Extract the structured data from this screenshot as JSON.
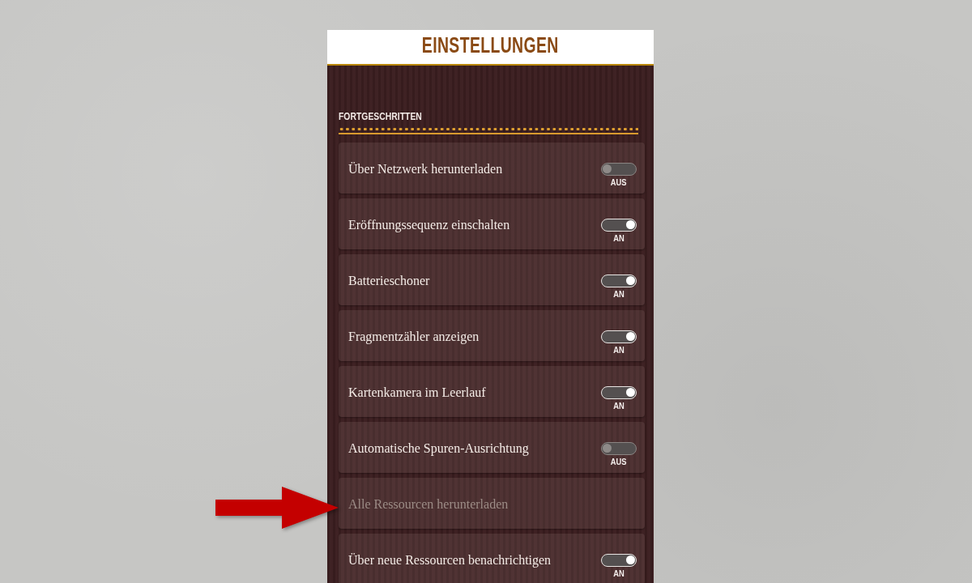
{
  "header": {
    "title": "EINSTELLUNGEN"
  },
  "section": {
    "title": "FORTGESCHRITTEN"
  },
  "settings": [
    {
      "kind": "toggle",
      "label": "Über Netzwerk herunterladen",
      "on": false,
      "state_label": "AUS",
      "disabled": false,
      "highlighted": false
    },
    {
      "kind": "toggle",
      "label": "Eröffnungssequenz einschalten",
      "on": true,
      "state_label": "AN",
      "disabled": false,
      "highlighted": false
    },
    {
      "kind": "toggle",
      "label": "Batterieschoner",
      "on": true,
      "state_label": "AN",
      "disabled": false,
      "highlighted": false
    },
    {
      "kind": "toggle",
      "label": "Fragmentzähler anzeigen",
      "on": true,
      "state_label": "AN",
      "disabled": false,
      "highlighted": false
    },
    {
      "kind": "toggle",
      "label": "Kartenkamera im Leerlauf",
      "on": true,
      "state_label": "AN",
      "disabled": false,
      "highlighted": false
    },
    {
      "kind": "toggle",
      "label": "Automatische Spuren-Ausrichtung",
      "on": false,
      "state_label": "AUS",
      "disabled": false,
      "highlighted": false
    },
    {
      "kind": "action",
      "label": "Alle Ressourcen herunterladen",
      "disabled": true,
      "highlighted": true
    },
    {
      "kind": "toggle",
      "label": "Über neue Ressourcen benachrichtigen",
      "on": true,
      "state_label": "AN",
      "disabled": false,
      "highlighted": false
    }
  ]
}
